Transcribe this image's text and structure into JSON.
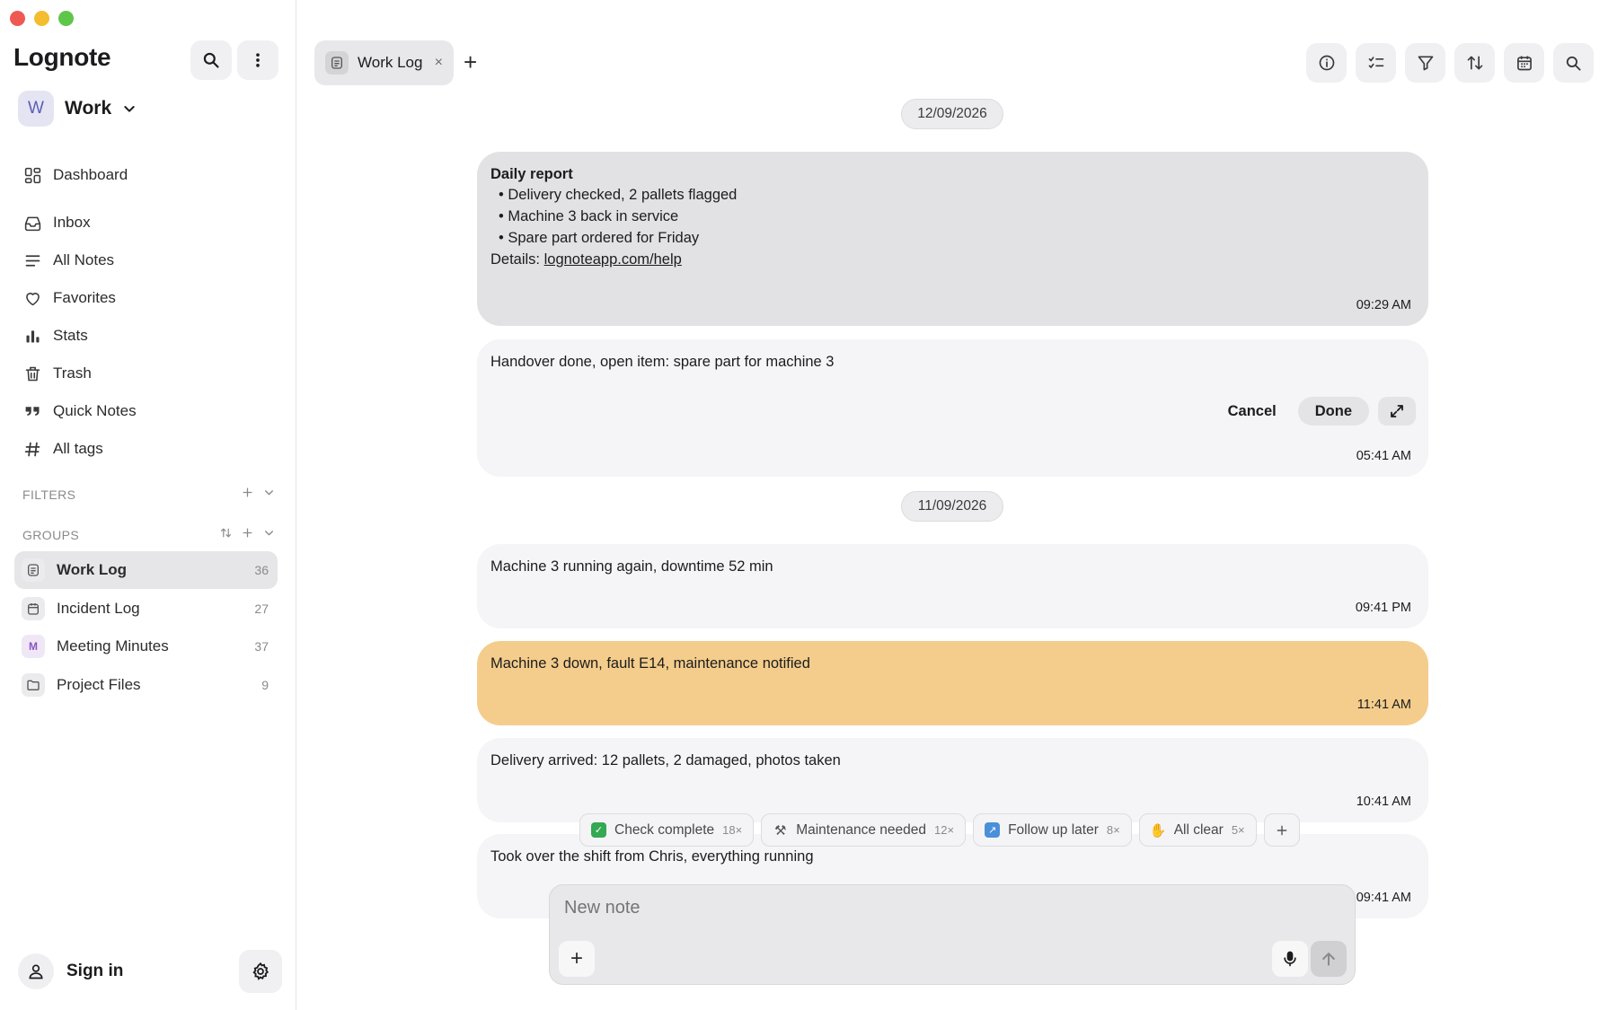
{
  "app": {
    "title": "Lognote"
  },
  "workspace": {
    "avatar": "W",
    "name": "Work"
  },
  "nav": [
    {
      "label": "Dashboard",
      "icon": "dashboard-icon"
    },
    {
      "label": "Inbox",
      "icon": "inbox-icon"
    },
    {
      "label": "All Notes",
      "icon": "list-icon"
    },
    {
      "label": "Favorites",
      "icon": "heart-icon"
    },
    {
      "label": "Stats",
      "icon": "bar-chart-icon"
    },
    {
      "label": "Trash",
      "icon": "trash-icon"
    },
    {
      "label": "Quick Notes",
      "icon": "quote-icon"
    },
    {
      "label": "All tags",
      "icon": "hash-icon"
    }
  ],
  "filters": {
    "label": "FILTERS"
  },
  "groups": {
    "label": "GROUPS",
    "items": [
      {
        "label": "Work Log",
        "count": "36",
        "active": true
      },
      {
        "label": "Incident Log",
        "count": "27"
      },
      {
        "label": "Meeting Minutes",
        "count": "37",
        "avatar": "M"
      },
      {
        "label": "Project Files",
        "count": "9"
      }
    ]
  },
  "account": {
    "signin": "Sign in"
  },
  "tab": {
    "label": "Work Log",
    "close": "×",
    "add": "+"
  },
  "dates": [
    "12/09/2026",
    "11/09/2026"
  ],
  "notes": [
    {
      "title": "Daily report",
      "bullets": [
        "Delivery checked, 2 pallets flagged",
        "Machine 3 back in service",
        "Spare part ordered for Friday"
      ],
      "details_prefix": "Details: ",
      "link": "lognoteapp.com/help",
      "time": "09:29 AM"
    },
    {
      "text": "Handover done, open item: spare part for machine 3",
      "time": "05:41 AM",
      "cancel": "Cancel",
      "done": "Done"
    },
    {
      "text": "Machine 3 running again, downtime 52 min",
      "time": "09:41 PM"
    },
    {
      "text": "Machine 3 down, fault E14, maintenance notified",
      "time": "11:41 AM"
    },
    {
      "text": "Delivery arrived: 12 pallets, 2 damaged, photos taken",
      "time": "10:41 AM"
    },
    {
      "text": "Took over the shift from Chris, everything running",
      "time": "09:41 AM"
    }
  ],
  "quick_notes": [
    {
      "label": "Check complete",
      "count": "18×",
      "color": "#34a853"
    },
    {
      "label": "Maintenance needed",
      "count": "12×",
      "color": "#6b6b6b"
    },
    {
      "label": "Follow up later",
      "count": "8×",
      "color": "#4a90d9"
    },
    {
      "label": "All clear",
      "count": "5×",
      "color": "#f2b233"
    }
  ],
  "composer": {
    "placeholder": "New note",
    "add": "+"
  },
  "colors": {
    "accent_orange": "#f4cd8c",
    "note_bg": "#f5f5f7",
    "selected_note_bg": "#e2e2e4"
  }
}
